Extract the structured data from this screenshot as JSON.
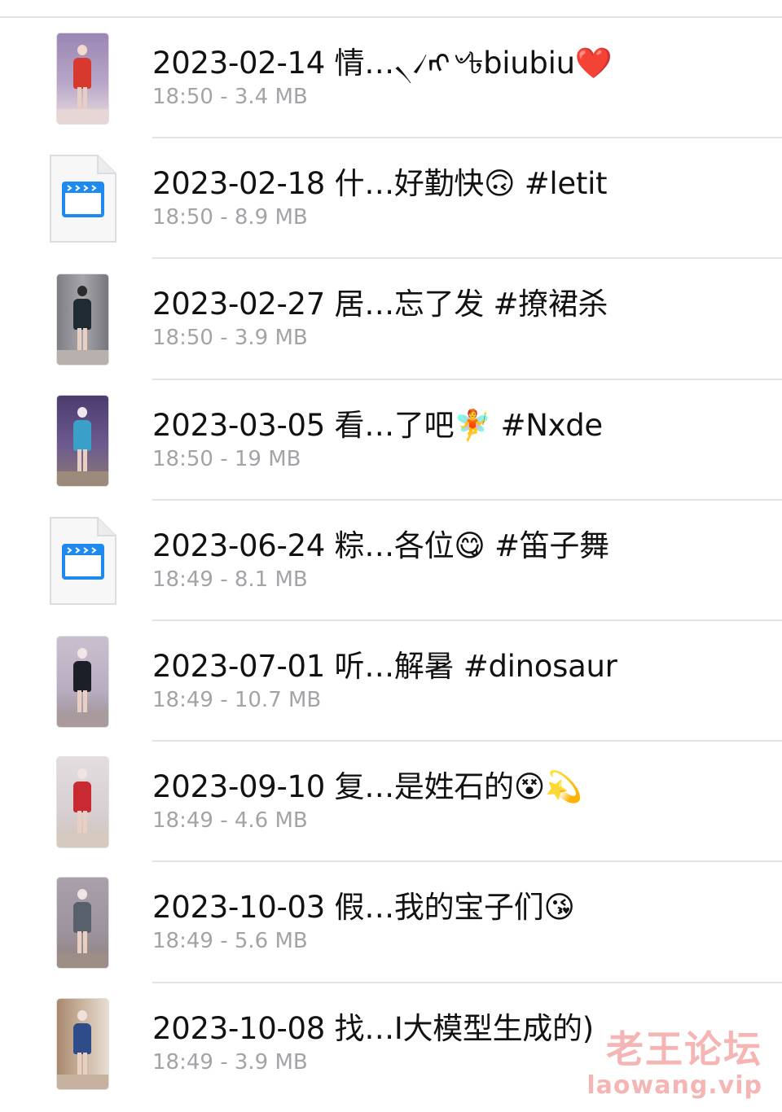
{
  "files": [
    {
      "title": "2023-02-14 情…৲৴ᡢ৺৳biubiu❤️",
      "meta": "18:50 - 3.4 MB",
      "icon": "video-thumbnail",
      "thumb_bg": "#8f7fa8",
      "thumb_body": "#d8392f",
      "thumb_floor": "#e6d6d6"
    },
    {
      "title": "2023-02-18 什…好勤快🙃 #letit",
      "meta": "18:50 - 8.9 MB",
      "icon": "video-file-icon"
    },
    {
      "title": "2023-02-27 居…忘了发 #撩裙杀",
      "meta": "18:50 - 3.9 MB",
      "icon": "video-thumbnail",
      "thumb_bg": "#8f8e93",
      "thumb_body": "#1f2a33",
      "thumb_floor": "#b7b0ac"
    },
    {
      "title": "2023-03-05 看…了吧🧚 #Nxde",
      "meta": "18:50 - 19 MB",
      "icon": "video-thumbnail",
      "thumb_bg": "#5a4a7a",
      "thumb_body": "#3aa0c8",
      "thumb_floor": "#9c8a7c"
    },
    {
      "title": "2023-06-24 粽…各位😋 #笛子舞",
      "meta": "18:49 - 8.1 MB",
      "icon": "video-file-icon"
    },
    {
      "title": "2023-07-01 听…解暑 #dinosaur",
      "meta": "18:49 - 10.7 MB",
      "icon": "video-thumbnail",
      "thumb_bg": "#c6bcc8",
      "thumb_body": "#1c1f28",
      "thumb_floor": "#a99b9b"
    },
    {
      "title": "2023-09-10 复…是姓石的😵💫",
      "meta": "18:49 - 4.6 MB",
      "icon": "video-thumbnail",
      "thumb_bg": "#d9d3d6",
      "thumb_body": "#c92a32",
      "thumb_floor": "#d6cabe"
    },
    {
      "title": "2023-10-03 假…我的宝子们😘",
      "meta": "18:49 - 5.6 MB",
      "icon": "video-thumbnail",
      "thumb_bg": "#a79da7",
      "thumb_body": "#58606c",
      "thumb_floor": "#9c8d87"
    },
    {
      "title": "2023-10-08 找…I大模型生成的)",
      "meta": "18:49 - 3.9 MB",
      "icon": "video-thumbnail",
      "thumb_bg": "#b89a80",
      "thumb_body": "#2f4c8a",
      "thumb_floor": "#c7b29f"
    }
  ],
  "watermark": {
    "title": "老王论坛",
    "url": "laowang.vip"
  },
  "colors": {
    "title_text": "#121212",
    "meta_text": "#a3a3a8",
    "divider": "#e4e4e6",
    "file_icon_blue": "#1e8af0"
  }
}
